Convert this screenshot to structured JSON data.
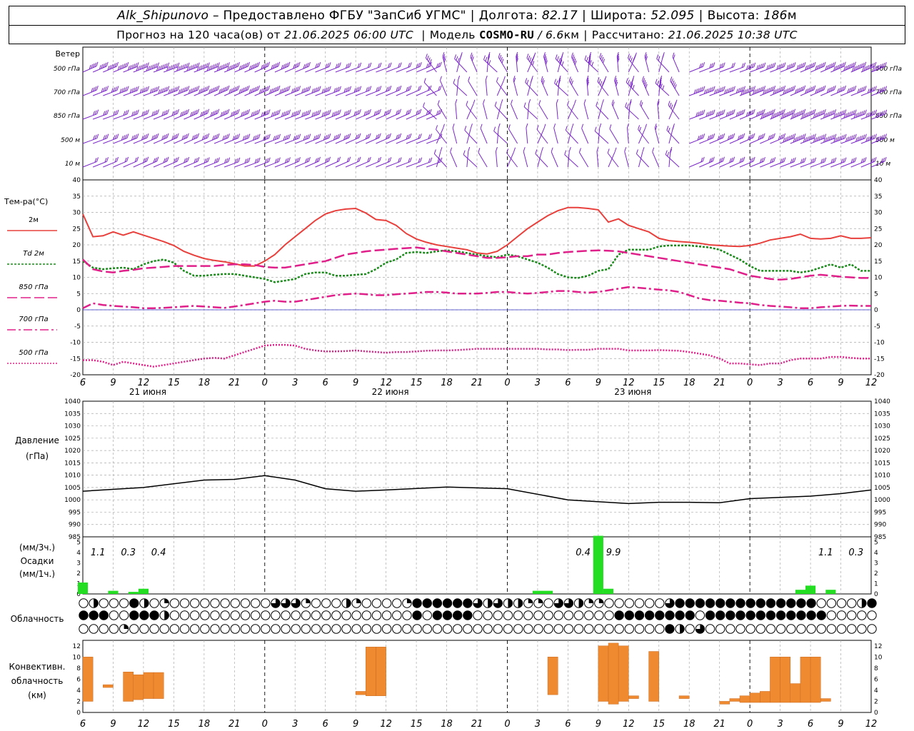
{
  "header": {
    "station": "Alk_Shipunovo",
    "provider": "– Предоставлено ФГБУ \"ЗапСиб УГМС\"",
    "lon_label": "Долгота:",
    "lon_value": "82.17",
    "lat_label": "Широта:",
    "lat_value": "52.095",
    "alt_label": "Высота:",
    "alt_value": "186",
    "alt_unit": "м",
    "forecast_label": "Прогноз на 120 часа(ов) от",
    "forecast_start": "21.06.2025 06:00 UTC",
    "model_label": "Модель",
    "model_name": "COSMO-RU",
    "model_res": "/ 6.6",
    "model_res_unit": "км",
    "calc_label": "Рассчитано:",
    "calc_time": "21.06.2025 10:38 UTC"
  },
  "x_ticks": [
    "6",
    "9",
    "12",
    "15",
    "18",
    "21",
    "0",
    "3",
    "6",
    "9",
    "12",
    "15",
    "18",
    "21",
    "0",
    "3",
    "6",
    "9",
    "12",
    "15",
    "18",
    "21",
    "0",
    "3",
    "6",
    "9",
    "12"
  ],
  "day_labels": [
    "21 июня",
    "22 июня",
    "23 июня"
  ],
  "colors": {
    "temp2m": "#e8403c",
    "td2m": "#1a8a1a",
    "t850": "#e0208a",
    "wind": "#7a28c8",
    "precip": "#22dd22",
    "convective": "#f08a30",
    "zero_line": "#3030c0"
  },
  "chart_data": [
    {
      "type": "barbs",
      "title": "Ветер",
      "levels": [
        "500 гПа",
        "700 гПа",
        "850 гПа",
        "500 м",
        "10  м"
      ],
      "note": "wind barbs at 1-hour intervals; strength increasing toward the start and end of the period"
    },
    {
      "type": "line",
      "title": "Тем-ра(°C)",
      "x": [
        6,
        7,
        8,
        9,
        10,
        11,
        12,
        13,
        14,
        15,
        16,
        17,
        18,
        19,
        20,
        21,
        22,
        23,
        24,
        25,
        26,
        27,
        28,
        29,
        30,
        31,
        32,
        33,
        34,
        35,
        36,
        37,
        38,
        39,
        40,
        41,
        42,
        43,
        44,
        45,
        46,
        47,
        48,
        49,
        50,
        51,
        52,
        53,
        54,
        55,
        56,
        57,
        58,
        59,
        60,
        61,
        62,
        63,
        64,
        65,
        66,
        67,
        68,
        69,
        70,
        71,
        72,
        73,
        74,
        75,
        76,
        77,
        78,
        79,
        80,
        81,
        82,
        83,
        84
      ],
      "ylim": [
        -20,
        40
      ],
      "yticks": [
        -20,
        -15,
        -10,
        -5,
        0,
        5,
        10,
        15,
        20,
        25,
        30,
        35,
        40
      ],
      "series": [
        {
          "name": "2м",
          "style": "solid",
          "values": [
            29.5,
            22.5,
            22.8,
            24.0,
            23.0,
            24.0,
            23.0,
            22.0,
            21.0,
            19.8,
            18.0,
            16.8,
            15.8,
            15.2,
            14.8,
            14.2,
            13.5,
            13.5,
            15.0,
            17.0,
            20.0,
            22.5,
            25.0,
            27.5,
            29.5,
            30.5,
            31.0,
            31.2,
            29.8,
            27.8,
            27.5,
            26.0,
            23.5,
            21.8,
            20.8,
            20.0,
            19.5,
            19.0,
            18.5,
            17.5,
            17.2,
            18.0,
            20.0,
            22.5,
            25.0,
            27.0,
            29.0,
            30.5,
            31.5,
            31.5,
            31.2,
            30.8,
            27.0,
            28.0,
            26.0,
            25.0,
            24.0,
            22.0,
            21.3,
            21.0,
            20.8,
            20.5,
            20.0,
            19.8,
            19.6,
            19.5,
            19.8,
            20.5,
            21.5,
            22.0,
            22.5,
            23.3,
            22.0,
            21.8,
            22.0,
            22.8,
            22.0,
            22.0,
            22.2
          ]
        },
        {
          "name": "Td  2м",
          "style": "dotted",
          "values": [
            15.0,
            13.0,
            12.5,
            12.8,
            13.0,
            12.5,
            14.0,
            15.0,
            15.5,
            14.5,
            12.0,
            10.5,
            10.5,
            10.8,
            11.0,
            11.0,
            10.5,
            10.0,
            9.5,
            8.5,
            9.0,
            9.5,
            11.0,
            11.5,
            11.5,
            10.5,
            10.5,
            10.8,
            11.0,
            12.5,
            14.5,
            15.5,
            17.5,
            17.8,
            17.5,
            18.0,
            18.3,
            18.0,
            17.5,
            17.0,
            16.5,
            16.2,
            17.0,
            16.5,
            15.5,
            14.5,
            13.0,
            11.0,
            10.0,
            9.8,
            10.5,
            12.0,
            12.5,
            17.0,
            18.5,
            18.5,
            18.5,
            19.5,
            19.8,
            19.8,
            19.8,
            19.5,
            19.2,
            18.5,
            17.0,
            15.5,
            13.5,
            12.0,
            12.0,
            12.0,
            12.0,
            11.5,
            12.0,
            13.0,
            14.0,
            13.0,
            14.0,
            12.0,
            12.0
          ]
        },
        {
          "name": "850 гПа",
          "style": "dashed",
          "values": [
            15.5,
            12.5,
            11.8,
            11.5,
            12.0,
            12.3,
            12.8,
            13.0,
            13.2,
            13.5,
            13.5,
            13.5,
            13.5,
            13.5,
            13.8,
            14.0,
            14.0,
            13.8,
            13.2,
            13.0,
            13.0,
            13.5,
            14.0,
            14.5,
            15.0,
            16.0,
            17.0,
            17.5,
            18.0,
            18.3,
            18.5,
            18.8,
            19.0,
            19.2,
            18.8,
            18.5,
            18.0,
            17.5,
            17.0,
            16.5,
            16.0,
            16.0,
            16.2,
            16.5,
            16.5,
            17.0,
            17.0,
            17.5,
            17.8,
            18.0,
            18.2,
            18.3,
            18.2,
            18.0,
            17.5,
            17.0,
            16.5,
            16.0,
            15.5,
            15.0,
            14.5,
            14.0,
            13.5,
            13.0,
            12.5,
            11.5,
            10.5,
            10.0,
            9.5,
            9.3,
            9.5,
            10.0,
            10.5,
            10.8,
            10.5,
            10.2,
            10.0,
            9.8,
            9.8
          ]
        },
        {
          "name": "700 гПа",
          "style": "dashdot",
          "values": [
            0.5,
            2.0,
            1.5,
            1.2,
            1.0,
            0.8,
            0.5,
            0.5,
            0.6,
            0.8,
            1.0,
            1.2,
            1.0,
            0.8,
            0.6,
            1.0,
            1.5,
            2.0,
            2.5,
            2.8,
            2.5,
            2.5,
            3.0,
            3.5,
            4.0,
            4.5,
            4.8,
            5.0,
            4.8,
            4.5,
            4.5,
            4.8,
            5.0,
            5.2,
            5.5,
            5.5,
            5.3,
            5.0,
            5.0,
            5.0,
            5.2,
            5.5,
            5.5,
            5.2,
            5.0,
            5.2,
            5.5,
            5.8,
            5.8,
            5.5,
            5.3,
            5.5,
            6.0,
            6.5,
            7.0,
            6.8,
            6.5,
            6.2,
            6.0,
            5.5,
            4.5,
            3.5,
            3.0,
            2.8,
            2.5,
            2.2,
            2.0,
            1.5,
            1.2,
            1.0,
            0.8,
            0.5,
            0.5,
            0.8,
            1.0,
            1.2,
            1.3,
            1.2,
            1.2
          ]
        },
        {
          "name": "500 гПа",
          "style": "dense-dot",
          "values": [
            -15.5,
            -15.5,
            -16.0,
            -17.0,
            -16.0,
            -16.5,
            -17.0,
            -17.5,
            -17.0,
            -16.5,
            -16.0,
            -15.5,
            -15.0,
            -14.8,
            -15.0,
            -14.0,
            -13.0,
            -12.0,
            -11.0,
            -10.8,
            -10.8,
            -11.0,
            -12.0,
            -12.5,
            -12.8,
            -12.8,
            -12.7,
            -12.5,
            -12.8,
            -13.0,
            -13.2,
            -13.0,
            -13.0,
            -12.8,
            -12.6,
            -12.5,
            -12.5,
            -12.4,
            -12.2,
            -12.0,
            -12.0,
            -12.0,
            -12.0,
            -12.0,
            -12.0,
            -12.0,
            -12.2,
            -12.2,
            -12.4,
            -12.3,
            -12.3,
            -12.0,
            -12.0,
            -12.0,
            -12.5,
            -12.5,
            -12.5,
            -12.4,
            -12.5,
            -12.6,
            -13.0,
            -13.5,
            -14.0,
            -15.0,
            -16.5,
            -16.5,
            -16.8,
            -17.0,
            -16.5,
            -16.5,
            -15.5,
            -15.0,
            -15.0,
            -15.0,
            -14.5,
            -14.5,
            -14.8,
            -15.0,
            -15.0
          ]
        }
      ]
    },
    {
      "type": "line",
      "title": "Давление",
      "subtitle": "(гПа)",
      "ylim": [
        985,
        1040
      ],
      "yticks": [
        985,
        990,
        995,
        1000,
        1005,
        1010,
        1015,
        1020,
        1025,
        1030,
        1035,
        1040
      ],
      "x": [
        6,
        12,
        18,
        21,
        24,
        27,
        30,
        33,
        36,
        42,
        48,
        54,
        60,
        63,
        66,
        69,
        72,
        75,
        78,
        81,
        84
      ],
      "values": [
        1003.5,
        1005.0,
        1008.0,
        1008.3,
        1009.8,
        1008.0,
        1004.5,
        1003.5,
        1004.0,
        1005.2,
        1004.5,
        1000.0,
        998.5,
        999.0,
        999.0,
        998.8,
        1000.5,
        1001.0,
        1001.5,
        1002.5,
        1004.0
      ]
    },
    {
      "type": "bar",
      "title": "(мм/3ч.)",
      "subtitle": "Осадки (мм/1ч.)",
      "ylim": [
        0,
        5.5
      ],
      "yticks": [
        0,
        1,
        2,
        3,
        4,
        5
      ],
      "x": [
        6,
        9,
        11,
        12,
        51,
        52,
        57,
        58,
        77,
        78,
        80
      ],
      "values": [
        1.1,
        0.3,
        0.2,
        0.5,
        0.3,
        0.3,
        5.6,
        0.5,
        0.4,
        0.8,
        0.4
      ],
      "totals": [
        {
          "x": 7.5,
          "label": "1.1"
        },
        {
          "x": 10.5,
          "label": "0.3"
        },
        {
          "x": 13.5,
          "label": "0.4"
        },
        {
          "x": 55.5,
          "label": "0.4"
        },
        {
          "x": 58.5,
          "label": "9.9"
        },
        {
          "x": 79.5,
          "label": "1.1"
        },
        {
          "x": 82.5,
          "label": "0.3"
        }
      ]
    },
    {
      "type": "table",
      "title": "Облачность",
      "note": "three rows of cloud-cover circles (0–4 octants filled) at 1-hour steps",
      "rows": [
        [
          0,
          2,
          0,
          0,
          0,
          4,
          2,
          0,
          1,
          0,
          0,
          0,
          0,
          0,
          0,
          0,
          0,
          0,
          0,
          3,
          3,
          3,
          1,
          0,
          0,
          0,
          2,
          1,
          0,
          0,
          0,
          0,
          1,
          4,
          4,
          4,
          4,
          4,
          4,
          3,
          2,
          3,
          2,
          2,
          1,
          1,
          0,
          3,
          3,
          2,
          1,
          1,
          0,
          0,
          0,
          0,
          0,
          0,
          3,
          4,
          4,
          4,
          4,
          4,
          4,
          4,
          4,
          4,
          4,
          4,
          4,
          4,
          4,
          0,
          0,
          0,
          0,
          2,
          4,
          4,
          4,
          2,
          0
        ],
        [
          4,
          4,
          4,
          0,
          0,
          4,
          4,
          4,
          2,
          0,
          0,
          0,
          0,
          0,
          0,
          0,
          0,
          0,
          0,
          0,
          0,
          0,
          0,
          0,
          0,
          0,
          0,
          0,
          0,
          0,
          0,
          0,
          0,
          4,
          0,
          4,
          4,
          4,
          4,
          0,
          0,
          0,
          0,
          0,
          0,
          0,
          0,
          0,
          0,
          0,
          0,
          0,
          0,
          4,
          4,
          4,
          4,
          4,
          4,
          4,
          4,
          0,
          4,
          4,
          4,
          4,
          4,
          4,
          4,
          4,
          4,
          4,
          4,
          4,
          0,
          0,
          0,
          0,
          0,
          3,
          4,
          4,
          2,
          0,
          0
        ],
        [
          0,
          0,
          0,
          0,
          1,
          0,
          0,
          0,
          0,
          0,
          0,
          0,
          0,
          0,
          0,
          0,
          0,
          0,
          0,
          0,
          0,
          0,
          0,
          0,
          0,
          0,
          0,
          0,
          0,
          0,
          0,
          0,
          0,
          0,
          0,
          0,
          0,
          0,
          0,
          0,
          0,
          0,
          0,
          0,
          0,
          0,
          0,
          0,
          0,
          0,
          0,
          0,
          0,
          0,
          0,
          0,
          0,
          0,
          4,
          2,
          0,
          3,
          0,
          0,
          0,
          0,
          0,
          0,
          0,
          0,
          0,
          0,
          0,
          0,
          0,
          0,
          0,
          0,
          0,
          0,
          0,
          1,
          2,
          1,
          0,
          4,
          4,
          4,
          4
        ]
      ]
    },
    {
      "type": "bar",
      "title": "Конвективн.",
      "subtitle": "облачность",
      "unit": "(км)",
      "ylim": [
        0,
        13
      ],
      "yticks": [
        0,
        2,
        4,
        6,
        8,
        10,
        12
      ],
      "bars": [
        {
          "x": 6,
          "bottom": 2,
          "top": 10
        },
        {
          "x": 8,
          "bottom": 4.5,
          "top": 5
        },
        {
          "x": 10,
          "bottom": 2,
          "top": 7.3
        },
        {
          "x": 11,
          "bottom": 2.3,
          "top": 6.8
        },
        {
          "x": 12,
          "bottom": 2.5,
          "top": 7.2
        },
        {
          "x": 13,
          "bottom": 2.5,
          "top": 7.2
        },
        {
          "x": 33,
          "bottom": 3.2,
          "top": 3.8
        },
        {
          "x": 34,
          "bottom": 3,
          "top": 11.8
        },
        {
          "x": 35,
          "bottom": 3,
          "top": 11.8
        },
        {
          "x": 52,
          "bottom": 3.2,
          "top": 10
        },
        {
          "x": 57,
          "bottom": 2,
          "top": 12
        },
        {
          "x": 58,
          "bottom": 1.5,
          "top": 12.5
        },
        {
          "x": 59,
          "bottom": 2,
          "top": 12
        },
        {
          "x": 60,
          "bottom": 2.5,
          "top": 3
        },
        {
          "x": 62,
          "bottom": 2,
          "top": 11
        },
        {
          "x": 65,
          "bottom": 2.5,
          "top": 3
        },
        {
          "x": 69,
          "bottom": 1.5,
          "top": 2
        },
        {
          "x": 70,
          "bottom": 2,
          "top": 2.5
        },
        {
          "x": 71,
          "bottom": 1.8,
          "top": 3
        },
        {
          "x": 72,
          "bottom": 1.8,
          "top": 3.5
        },
        {
          "x": 73,
          "bottom": 1.8,
          "top": 3.8
        },
        {
          "x": 74,
          "bottom": 1.8,
          "top": 10
        },
        {
          "x": 75,
          "bottom": 1.8,
          "top": 10
        },
        {
          "x": 76,
          "bottom": 1.8,
          "top": 5.2
        },
        {
          "x": 77,
          "bottom": 1.8,
          "top": 10
        },
        {
          "x": 78,
          "bottom": 1.8,
          "top": 10
        },
        {
          "x": 79,
          "bottom": 2,
          "top": 2.5
        }
      ]
    }
  ]
}
